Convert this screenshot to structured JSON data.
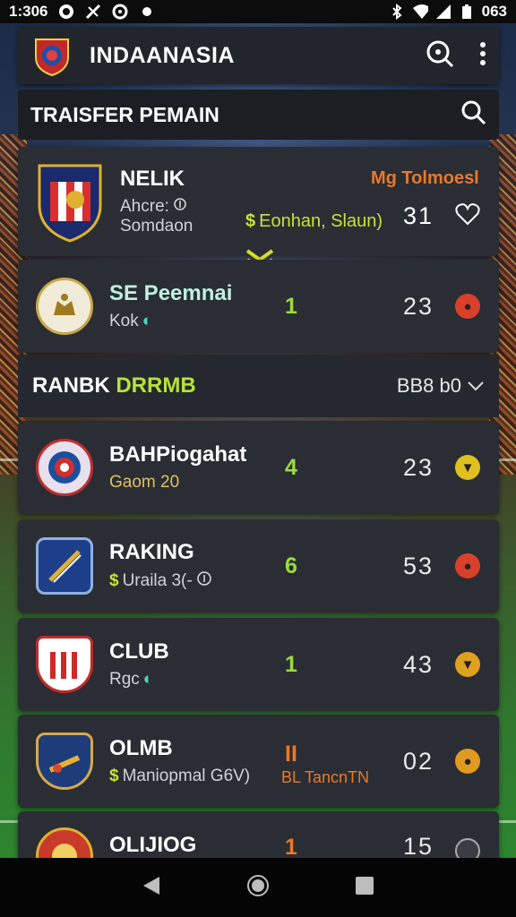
{
  "status": {
    "time": "1:306",
    "battery": "063"
  },
  "app": {
    "title": "INDAANASIA"
  },
  "search": {
    "label": "TRAISFER PEMAIN"
  },
  "featured": {
    "name": "NELIK",
    "sub1": "Ahcre:",
    "sub2": "Somdaon",
    "tag": "Mg Tolmoesl",
    "mid": "Eonhan, Slaun)",
    "score": "31"
  },
  "second": {
    "name": "SE Peemnai",
    "sub": "Kok",
    "mid": "1",
    "score": "23"
  },
  "section": {
    "title_a": "RANBK ",
    "title_b": "DRRMB",
    "sort": "BB8 b0"
  },
  "rows": [
    {
      "name": "BAHPiogahat",
      "sub": "Gaom 20",
      "mid": "4",
      "score": "23",
      "color": "#e0c020"
    },
    {
      "name": "RAKING",
      "sub": "Uraila 3(-",
      "mid": "6",
      "score": "53",
      "color": "#d9402a"
    },
    {
      "name": "CLUB",
      "sub": "Rgc",
      "mid": "1",
      "score": "43",
      "color": "#e0a020"
    },
    {
      "name": "OLMB",
      "sub": "Maniopmal G6V)",
      "mid": "II",
      "mid2": "BL TancnTN",
      "score": "02",
      "color": "#e09a20"
    },
    {
      "name": "OLIJIOG",
      "sub": "",
      "mid": "1",
      "score": "15",
      "color": "#777777"
    }
  ],
  "colors": {
    "accent_green": "#9bdc3a",
    "accent_orange": "#e8792a",
    "card": "#2a2d33"
  }
}
